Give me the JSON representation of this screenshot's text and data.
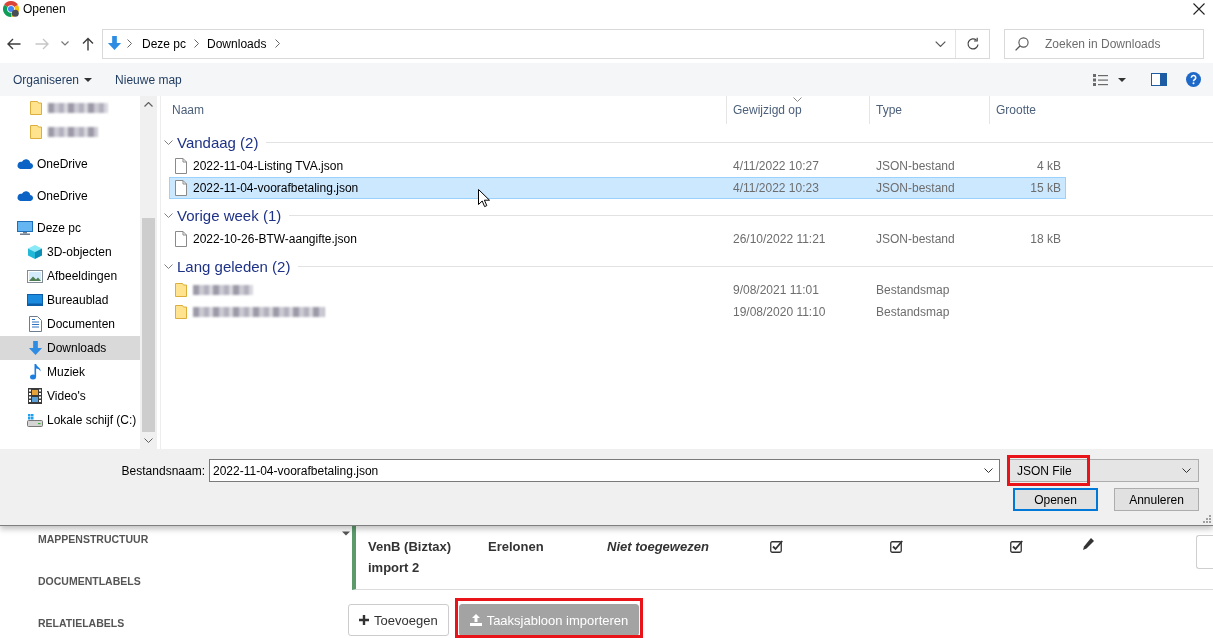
{
  "window": {
    "title": "Openen"
  },
  "nav": {
    "buttons": [
      {
        "kind": "back",
        "disabled": false
      },
      {
        "kind": "forward",
        "disabled": true
      },
      {
        "kind": "recent",
        "disabled": false
      },
      {
        "kind": "up",
        "disabled": false
      }
    ],
    "path": [
      "Deze pc",
      "Downloads"
    ],
    "search": {
      "placeholder": "Zoeken in Downloads"
    }
  },
  "toolbar": {
    "items": [
      {
        "label": "Organiseren",
        "dropdown": true
      },
      {
        "label": "Nieuwe map",
        "dropdown": false
      }
    ]
  },
  "sidebar": {
    "items": [
      {
        "kind": "folder",
        "redacted": true,
        "selected": false
      },
      {
        "kind": "folder",
        "redacted": true,
        "selected": false
      },
      {
        "kind": "cloud",
        "label": "OneDrive",
        "redacted": false,
        "selected": false
      },
      {
        "kind": "cloud",
        "label": "OneDrive",
        "redacted": false,
        "selected": false
      },
      {
        "kind": "pc",
        "label": "Deze pc",
        "redacted": false,
        "selected": false,
        "children": [
          {
            "kind": "cube",
            "label": "3D-objecten",
            "redacted": false,
            "selected": false
          },
          {
            "kind": "pictures",
            "label": "Afbeeldingen",
            "redacted": false,
            "selected": false
          },
          {
            "kind": "desktop",
            "label": "Bureaublad",
            "redacted": false,
            "selected": false
          },
          {
            "kind": "documents",
            "label": "Documenten",
            "redacted": false,
            "selected": false
          },
          {
            "kind": "downloads",
            "label": "Downloads",
            "redacted": false,
            "selected": true
          },
          {
            "kind": "music",
            "label": "Muziek",
            "redacted": false,
            "selected": false
          },
          {
            "kind": "videos",
            "label": "Video's",
            "redacted": false,
            "selected": false
          },
          {
            "kind": "drive",
            "label": "Lokale schijf (C:)",
            "redacted": false,
            "selected": false
          }
        ]
      }
    ]
  },
  "file_list": {
    "columns": [
      {
        "label": "Naam",
        "sorted": false
      },
      {
        "label": "Gewijzigd op",
        "sorted": true
      },
      {
        "label": "Type",
        "sorted": false
      },
      {
        "label": "Grootte",
        "sorted": false
      }
    ],
    "groups": [
      {
        "label": "Vandaag (2)",
        "expanded": true,
        "files": [
          {
            "kind": "json",
            "name": "2022-11-04-Listing TVA.json",
            "redacted": false,
            "modified": "4/11/2022 10:27",
            "type": "JSON-bestand",
            "size": "4 kB",
            "selected": false
          },
          {
            "kind": "json",
            "name": "2022-11-04-voorafbetaling.json",
            "redacted": false,
            "modified": "4/11/2022 10:23",
            "type": "JSON-bestand",
            "size": "15 kB",
            "selected": true
          }
        ]
      },
      {
        "label": "Vorige week (1)",
        "expanded": true,
        "files": [
          {
            "kind": "json",
            "name": "2022-10-26-BTW-aangifte.json",
            "redacted": false,
            "modified": "26/10/2022 11:21",
            "type": "JSON-bestand",
            "size": "18 kB",
            "selected": false
          }
        ]
      },
      {
        "label": "Lang geleden (2)",
        "expanded": true,
        "files": [
          {
            "kind": "folder",
            "redacted": true,
            "modified": "9/08/2021 11:01",
            "type": "Bestandsmap",
            "selected": false
          },
          {
            "kind": "folder",
            "redacted": true,
            "modified": "19/08/2020 11:10",
            "type": "Bestandsmap",
            "selected": false
          }
        ]
      }
    ]
  },
  "footer": {
    "filename_label": "Bestandsnaam:",
    "filename": "2022-11-04-voorafbetaling.json",
    "filter": {
      "value": "JSON File",
      "highlighted": true
    },
    "buttons": [
      {
        "label": "Openen",
        "default": true
      },
      {
        "label": "Annuleren",
        "default": false
      }
    ]
  },
  "page": {
    "menu": [
      {
        "label": "MAPPENSTRUCTUUR"
      },
      {
        "label": "DOCUMENTLABELS"
      },
      {
        "label": "RELATIELABELS"
      }
    ],
    "task": {
      "name": "VenB (Biztax) import 2",
      "category": "Erelonen",
      "assignee": "Niet toegewezen",
      "flags": [
        {
          "checked": true
        },
        {
          "checked": true
        },
        {
          "checked": true
        }
      ]
    },
    "buttons": [
      {
        "kind": "add",
        "label": "Toevoegen",
        "disabled": false,
        "highlighted": false
      },
      {
        "kind": "import",
        "label": "Taaksjabloon importeren",
        "disabled": true,
        "highlighted": true
      }
    ]
  }
}
